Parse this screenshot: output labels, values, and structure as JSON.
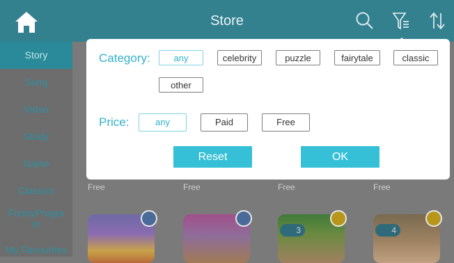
{
  "header": {
    "title": "Store",
    "icons": [
      "home-icon",
      "search-icon",
      "filter-icon",
      "sort-icon"
    ]
  },
  "sidebar": {
    "items": [
      {
        "label": "Story",
        "active": true
      },
      {
        "label": "Song"
      },
      {
        "label": "Video"
      },
      {
        "label": "Study"
      },
      {
        "label": "Game"
      },
      {
        "label": "Classics"
      },
      {
        "label": "FunnyProgram"
      },
      {
        "label": "My Favourites"
      }
    ]
  },
  "filter": {
    "category_label": "Category:",
    "category_options": [
      "any",
      "celebrity",
      "puzzle",
      "fairytale",
      "classic",
      "other"
    ],
    "category_selected": "any",
    "price_label": "Price:",
    "price_options": [
      "any",
      "Paid",
      "Free"
    ],
    "price_selected": "any",
    "reset_label": "Reset",
    "ok_label": "OK"
  },
  "grid": {
    "items": [
      {
        "price": "Free",
        "badge_icon": "lock-icon"
      },
      {
        "price": "Free",
        "badge_icon": "lock-icon"
      },
      {
        "price": "Free",
        "badge_icon": "bike-icon",
        "count": "3"
      },
      {
        "price": "Free",
        "badge_icon": "bike-icon",
        "count": "4"
      }
    ]
  },
  "colors": {
    "header_bg": "#33808f",
    "accent": "#35c0d7",
    "accent_text": "#33b1c9"
  }
}
